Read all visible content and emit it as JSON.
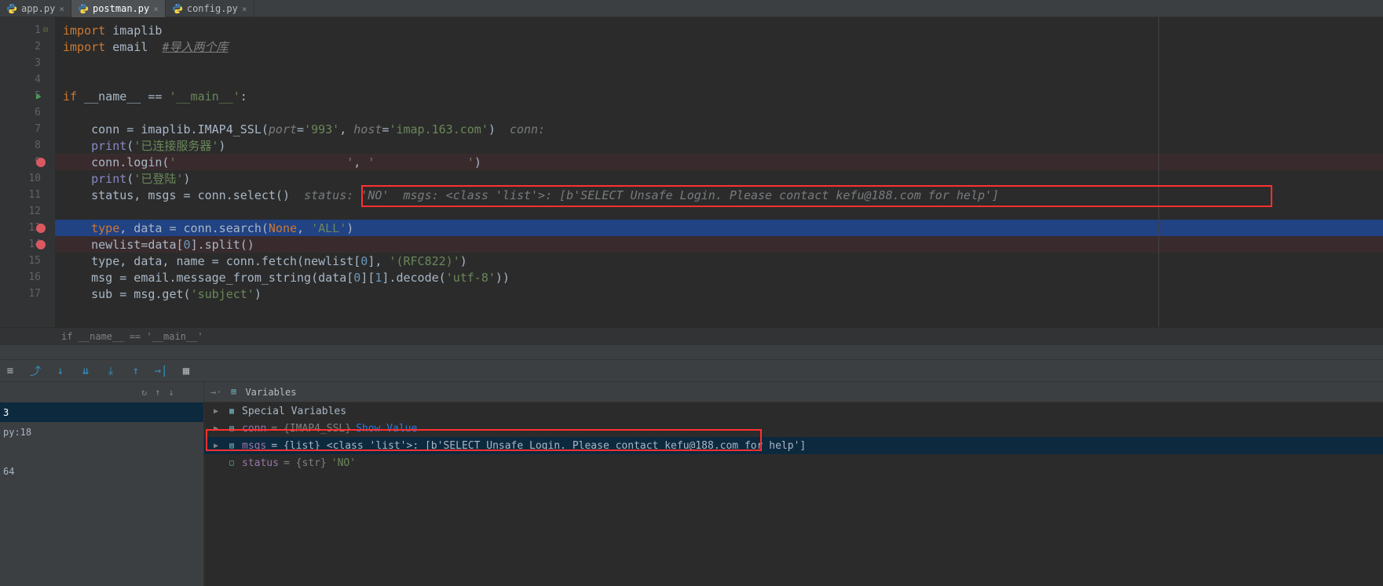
{
  "tabs": [
    {
      "name": "app.py",
      "active": false
    },
    {
      "name": "postman.py",
      "active": true
    },
    {
      "name": "config.py",
      "active": false
    }
  ],
  "lines": {
    "l1": "import imaplib",
    "l2a": "import email  ",
    "l2b": "#导入两个库",
    "l5": "if __name__ == '__main__':",
    "l7": "    conn = imaplib.IMAP4_SSL(port='993', host='imap.163.com')  conn:",
    "l8": "    print('已连接服务器')",
    "l9": "    conn.login('                        ','            ')",
    "l10": "    print('已登陆')",
    "l11a": "    status, msgs = conn.select()  ",
    "l11b": "status: 'NO'  msgs: <class 'list'>: [b'SELECT Unsafe Login. Please contact kefu@188.com for help']",
    "l13": "    type, data = conn.search(None, 'ALL')",
    "l14": "    newlist=data[0].split()",
    "l15": "    type, data, name = conn.fetch(newlist[0], '(RFC822)')",
    "l16": "    msg = email.message_from_string(data[0][1].decode('utf-8'))",
    "l17": "    sub = msg.get('subject')"
  },
  "breadcrumb": "if __name__ == '__main__'",
  "vars_label": "Variables",
  "special_vars": "Special Variables",
  "var_conn_name": "conn",
  "var_conn_type": " = {IMAP4_SSL} ",
  "var_conn_link": "Show Value",
  "var_msgs_name": "msgs",
  "var_msgs_full": " = {list} <class 'list'>: [b'SELECT Unsafe Login. Please contact kefu@188.com for help']",
  "var_status_name": "status",
  "var_status_type": " = {str} ",
  "var_status_val": "'NO'",
  "frame_sel": "3",
  "frame_loc": "py:18",
  "frame_bottom": "64"
}
